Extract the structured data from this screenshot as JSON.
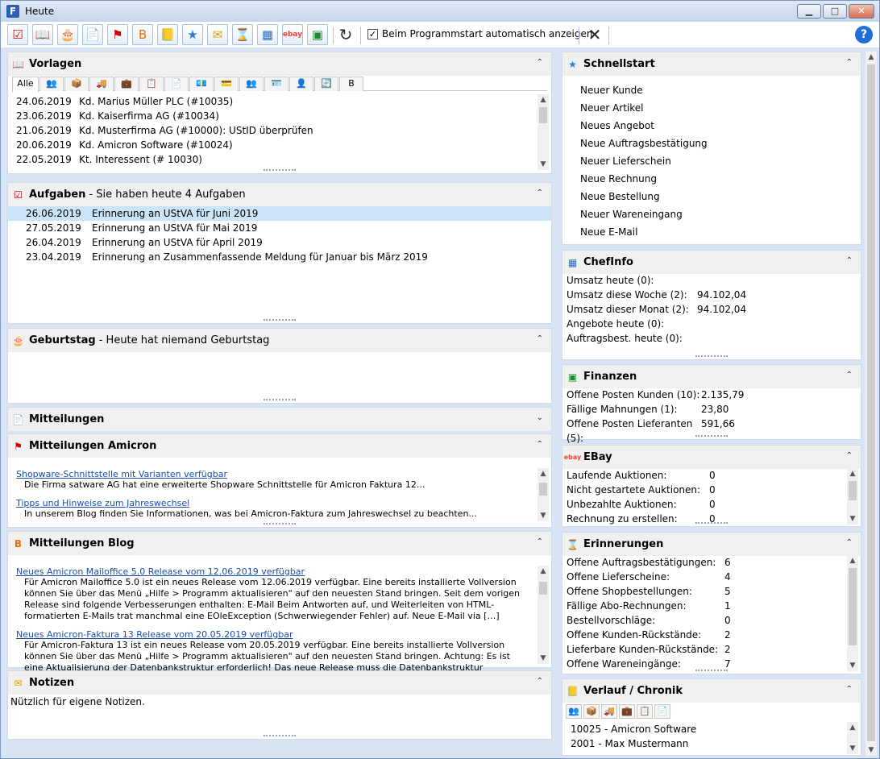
{
  "window": {
    "title": "Heute",
    "app_letter": "F",
    "btn_min": "▁",
    "btn_max": "□",
    "btn_close": "✕"
  },
  "toolbar": {
    "icons": [
      {
        "name": "aufgaben-icon",
        "glyph": "☑",
        "color": "#cc0000"
      },
      {
        "name": "vorlagen-icon",
        "glyph": "📖",
        "color": "#1b5fc1"
      },
      {
        "name": "geburtstag-icon",
        "glyph": "🎂",
        "color": "#d59a00"
      },
      {
        "name": "mitteilungen-icon",
        "glyph": "📄",
        "color": "#556"
      },
      {
        "name": "mitteilungen-amicron-icon",
        "glyph": "⚑",
        "color": "#cc0000"
      },
      {
        "name": "blog-icon",
        "glyph": "B",
        "color": "#e86f00"
      },
      {
        "name": "verlauf-icon",
        "glyph": "📒",
        "color": "#6a4"
      },
      {
        "name": "schnellstart-icon",
        "glyph": "★",
        "color": "#2a7fd4"
      },
      {
        "name": "notizen-icon",
        "glyph": "✉",
        "color": "#d8a300"
      },
      {
        "name": "erinnerungen-icon",
        "glyph": "⌛",
        "color": "#a86"
      },
      {
        "name": "chefinfo-icon",
        "glyph": "▦",
        "color": "#2a6fc1"
      },
      {
        "name": "ebay-icon",
        "glyph": "ebay",
        "color": "#e43"
      },
      {
        "name": "finanzen-icon",
        "glyph": "▣",
        "color": "#1a8a2a"
      }
    ],
    "refresh_glyph": "↻",
    "autoshow_label": "Beim Programmstart automatisch anzeigen",
    "autoshow_checked": "✓",
    "close_glyph": "✕",
    "help_glyph": "?"
  },
  "vorlagen": {
    "title": "Vorlagen",
    "collapse": "⌃",
    "tab_all": "Alle",
    "tabs": [
      "👥",
      "📦",
      "🚚",
      "💼",
      "📋",
      "📄",
      "💶",
      "💳",
      "👥",
      "🪪",
      "👤",
      "🔄",
      "B"
    ],
    "rows": [
      {
        "date": "24.06.2019",
        "text": "Kd. Marius Müller PLC (#10035)"
      },
      {
        "date": "23.06.2019",
        "text": "Kd. Kaiserfirma AG (#10034)"
      },
      {
        "date": "21.06.2019",
        "text": "Kd. Musterfirma AG (#10000): UStID überprüfen"
      },
      {
        "date": "20.06.2019",
        "text": "Kd. Amicron Software (#10024)"
      },
      {
        "date": "22.05.2019",
        "text": "Kt. Interessent (# 10030)"
      }
    ]
  },
  "aufgaben": {
    "title": "Aufgaben",
    "subtitle": "- Sie haben heute 4 Aufgaben",
    "rows": [
      {
        "date": "26.06.2019",
        "text": "Erinnerung an UStVA für Juni 2019"
      },
      {
        "date": "27.05.2019",
        "text": "Erinnerung an UStVA für Mai 2019"
      },
      {
        "date": "26.04.2019",
        "text": "Erinnerung an UStVA für April 2019"
      },
      {
        "date": "23.04.2019",
        "text": "Erinnerung an Zusammenfassende Meldung für Januar bis März 2019"
      }
    ]
  },
  "geburtstag": {
    "title": "Geburtstag",
    "subtitle": "- Heute hat niemand Geburtstag"
  },
  "mitteilungen": {
    "title": "Mitteilungen",
    "expand": "⌄"
  },
  "amicron": {
    "title": "Mitteilungen Amicron",
    "items": [
      {
        "link": "Shopware-Schnittstelle mit Varianten verfügbar",
        "text": "Die Firma satware AG hat eine erweiterte Shopware Schnittstelle für Amicron Faktura 12..."
      },
      {
        "link": "Tipps und Hinweise zum Jahreswechsel",
        "text": "In unserem Blog finden Sie Informationen, was bei Amicron-Faktura zum Jahreswechsel zu beachten..."
      }
    ]
  },
  "blog": {
    "title": "Mitteilungen Blog",
    "items": [
      {
        "link": "Neues Amicron Mailoffice 5.0 Release vom 12.06.2019 verfügbar",
        "lines": [
          "Für Amicron Mailoffice 5.0 ist ein neues Release vom 12.06.2019 verfügbar. Eine bereits installierte Vollversion",
          "können Sie über das Menü „Hilfe > Programm aktualisieren\" auf den neuesten Stand bringen. Seit dem vorigen",
          "Release sind folgende Verbesserungen enthalten: E-Mail Beim Antworten auf, und Weiterleiten von HTML-",
          "formatierten E-Mails trat manchmal eine EOleException (Schwerwiegender Fehler) auf. Neue E-Mail via […]"
        ]
      },
      {
        "link": "Neues Amicron-Faktura 13 Release vom 20.05.2019 verfügbar",
        "lines": [
          "Für Amicron-Faktura 13 ist ein neues Release vom 20.05.2019 verfügbar. Eine bereits installierte Vollversion",
          "können Sie über das Menü „Hilfe > Programm aktualisieren\" auf den neuesten Stand bringen. Achtung: Es ist",
          "eine Aktualisierung der Datenbankstruktur erforderlich! Das neue Release muss die Datenbankstruktur"
        ]
      }
    ]
  },
  "notizen": {
    "title": "Notizen",
    "text": "Nützlich für eigene Notizen."
  },
  "schnellstart": {
    "title": "Schnellstart",
    "items": [
      "Neuer Kunde",
      "Neuer Artikel",
      "Neues Angebot",
      "Neue Auftragsbestätigung",
      "Neuer Lieferschein",
      "Neue Rechnung",
      "Neue Bestellung",
      "Neuer Wareneingang",
      "Neue E-Mail"
    ]
  },
  "chefinfo": {
    "title": "ChefInfo",
    "rows": [
      {
        "k": "Umsatz heute (0):",
        "v": ""
      },
      {
        "k": "Umsatz diese Woche (2):",
        "v": "94.102,04"
      },
      {
        "k": "Umsatz dieser Monat (2):",
        "v": "94.102,04"
      },
      {
        "k": "Angebote heute (0):",
        "v": ""
      },
      {
        "k": "Auftragsbest. heute (0):",
        "v": ""
      }
    ]
  },
  "finanzen": {
    "title": "Finanzen",
    "rows": [
      {
        "k": "Offene Posten Kunden (10):",
        "v": "2.135,79"
      },
      {
        "k": "Fällige Mahnungen (1):",
        "v": "23,80"
      },
      {
        "k": "Offene Posten Lieferanten (5):",
        "v": "591,66"
      }
    ]
  },
  "ebay": {
    "title": "EBay",
    "rows": [
      {
        "k": "Laufende Auktionen:",
        "v": "0"
      },
      {
        "k": "Nicht gestartete Auktionen:",
        "v": "0"
      },
      {
        "k": "Unbezahlte Auktionen:",
        "v": "0"
      },
      {
        "k": "Rechnung zu erstellen:",
        "v": "0"
      }
    ]
  },
  "erinnerungen": {
    "title": "Erinnerungen",
    "rows": [
      {
        "k": "Offene Auftragsbestätigungen:",
        "v": "6"
      },
      {
        "k": "Offene Lieferscheine:",
        "v": "4"
      },
      {
        "k": "Offene Shopbestellungen:",
        "v": "5"
      },
      {
        "k": "Fällige Abo-Rechnungen:",
        "v": "1"
      },
      {
        "k": "Bestellvorschläge:",
        "v": "0"
      },
      {
        "k": "Offene Kunden-Rückstände:",
        "v": "2"
      },
      {
        "k": "Lieferbare Kunden-Rückstände:",
        "v": "2"
      },
      {
        "k": "Offene Wareneingänge:",
        "v": "7"
      }
    ]
  },
  "verlauf": {
    "title": "Verlauf / Chronik",
    "tabs": [
      "👥",
      "📦",
      "🚚",
      "💼",
      "📋",
      "📄"
    ],
    "rows": [
      "10025 - Amicron Software",
      "2001 - Max Mustermann"
    ]
  },
  "common": {
    "collapse": "⌃",
    "scroll_up": "▲",
    "scroll_down": "▼"
  }
}
